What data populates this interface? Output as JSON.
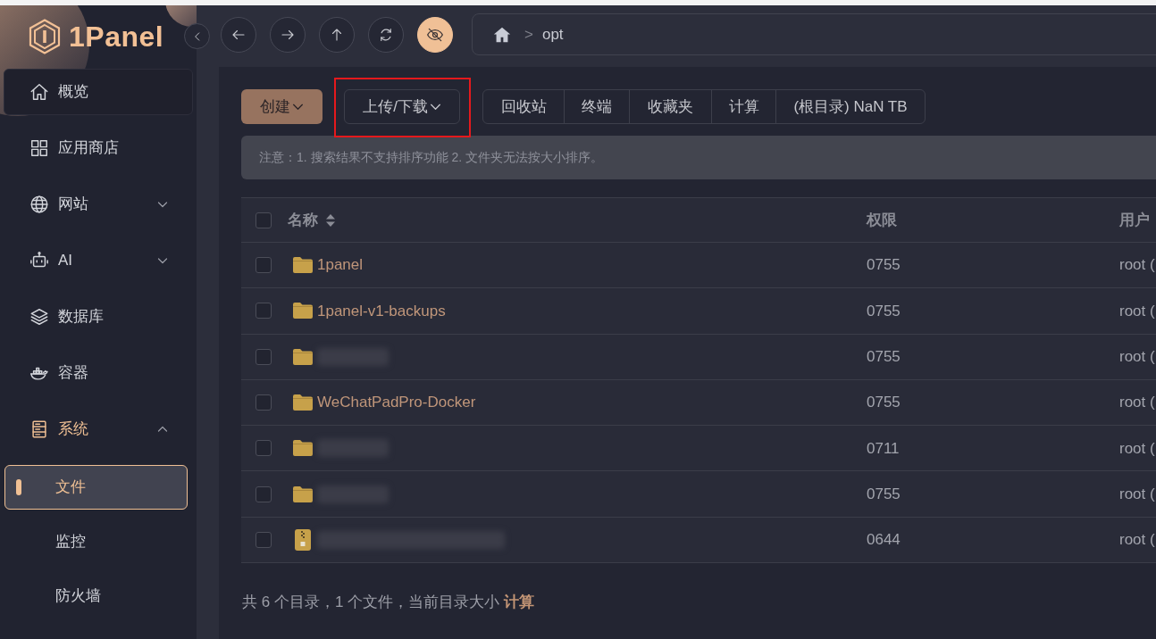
{
  "logo": {
    "text": "1Panel"
  },
  "sidebar": {
    "items": [
      {
        "label": "概览",
        "hovered": true,
        "selected": false
      },
      {
        "label": "应用商店",
        "hovered": false,
        "selected": false
      },
      {
        "label": "网站",
        "hovered": false,
        "selected": false,
        "expanded": false
      },
      {
        "label": "AI",
        "hovered": false,
        "selected": false,
        "expanded": false
      },
      {
        "label": "数据库",
        "hovered": false,
        "selected": false
      },
      {
        "label": "容器",
        "hovered": false,
        "selected": false
      },
      {
        "label": "系统",
        "hovered": false,
        "selected": false,
        "expanded": true,
        "children": [
          {
            "label": "文件",
            "selected": true
          },
          {
            "label": "监控",
            "selected": false
          },
          {
            "label": "防火墙",
            "selected": false
          }
        ]
      }
    ]
  },
  "top_bar": {
    "hidden_files_toggle": {
      "on": true
    },
    "breadcrumb": {
      "separator": ">",
      "path": [
        "opt"
      ]
    }
  },
  "toolbar": {
    "buttons": [
      {
        "label": "创建",
        "kind": "primary",
        "annotated": false
      },
      {
        "label": "上传/下载",
        "kind": "outline",
        "annotated": true
      }
    ],
    "button_group": [
      {
        "label": "回收站"
      },
      {
        "label": "终端"
      },
      {
        "label": "收藏夹"
      },
      {
        "label": "计算"
      },
      {
        "label": "(根目录) NaN TB"
      }
    ]
  },
  "notice": {
    "text": "注意：1. 搜索结果不支持排序功能 2. 文件夹无法按大小排序。"
  },
  "table": {
    "all_checked": false,
    "columns": [
      {
        "label": "名称",
        "sortable": true
      },
      {
        "label": "权限",
        "sortable": false
      },
      {
        "label": "用户",
        "sortable": false
      }
    ],
    "rows": [
      {
        "kind": "folder",
        "redacted": false,
        "name": "1panel",
        "checked": false,
        "permission": "0755",
        "user": "root ("
      },
      {
        "kind": "folder",
        "redacted": false,
        "name": "1panel-v1-backups",
        "checked": false,
        "permission": "0755",
        "user": "root ("
      },
      {
        "kind": "folder",
        "redacted": true,
        "checked": false,
        "permission": "0755",
        "user": "root ("
      },
      {
        "kind": "folder",
        "redacted": false,
        "name": "WeChatPadPro-Docker",
        "checked": false,
        "permission": "0755",
        "user": "root ("
      },
      {
        "kind": "folder",
        "redacted": true,
        "checked": false,
        "permission": "0711",
        "user": "root ("
      },
      {
        "kind": "folder",
        "redacted": true,
        "checked": false,
        "permission": "0755",
        "user": "root ("
      },
      {
        "kind": "archive",
        "redacted": true,
        "checked": false,
        "permission": "0644",
        "user": "root ("
      }
    ]
  },
  "footer": {
    "summary": "共 6 个目录，1 个文件，当前目录大小",
    "link": "计算"
  }
}
